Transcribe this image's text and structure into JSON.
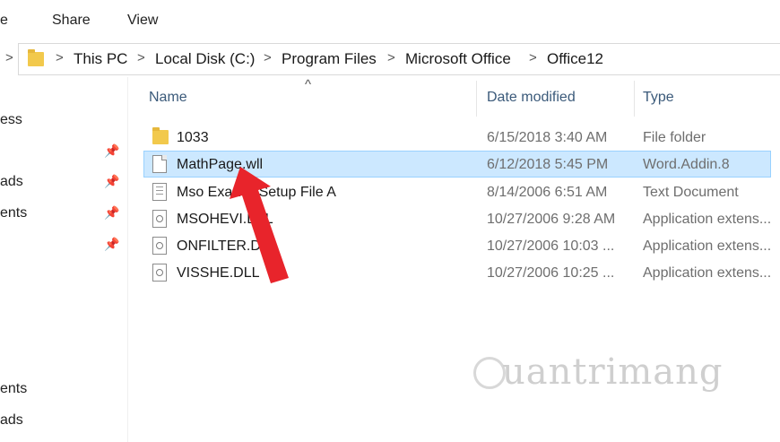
{
  "ribbon": {
    "file_fragment": "e",
    "share": "Share",
    "view": "View"
  },
  "address": {
    "crumbs": [
      "This PC",
      "Local Disk (C:)",
      "Program Files",
      "Microsoft Office",
      "Office12"
    ],
    "separator": ">",
    "left_chevron": ">"
  },
  "nav": {
    "items": [
      {
        "label": "ess"
      },
      {
        "label": "ads"
      },
      {
        "label": "ents"
      },
      {
        "label": "ents"
      },
      {
        "label": "ads"
      }
    ],
    "pin_glyph": "📌"
  },
  "columns": {
    "name": "Name",
    "date": "Date modified",
    "type": "Type",
    "sort_caret": "^"
  },
  "files": [
    {
      "name": "1033",
      "date": "6/15/2018 3:40 AM",
      "type": "File folder",
      "icon": "folder-icon"
    },
    {
      "name": "MathPage.wll",
      "date": "6/12/2018 5:45 PM",
      "type": "Word.Addin.8",
      "icon": "file-icon",
      "selected": true
    },
    {
      "name": "Mso Exa…e Setup File A",
      "date": "8/14/2006 6:51 AM",
      "type": "Text Document",
      "icon": "text-file-icon"
    },
    {
      "name": "MSOHEVI.DLL",
      "date": "10/27/2006 9:28 AM",
      "type": "Application extens...",
      "icon": "dll-icon"
    },
    {
      "name": "ONFILTER.DL",
      "date": "10/27/2006 10:03 ...",
      "type": "Application extens...",
      "icon": "dll-icon"
    },
    {
      "name": "VISSHE.DLL",
      "date": "10/27/2006 10:25 ...",
      "type": "Application extens...",
      "icon": "dll-icon"
    }
  ],
  "watermark": {
    "text": "uantrimang"
  },
  "colors": {
    "selection": "#cce8ff",
    "arrow": "#e8242b",
    "folder": "#f2c94c"
  }
}
